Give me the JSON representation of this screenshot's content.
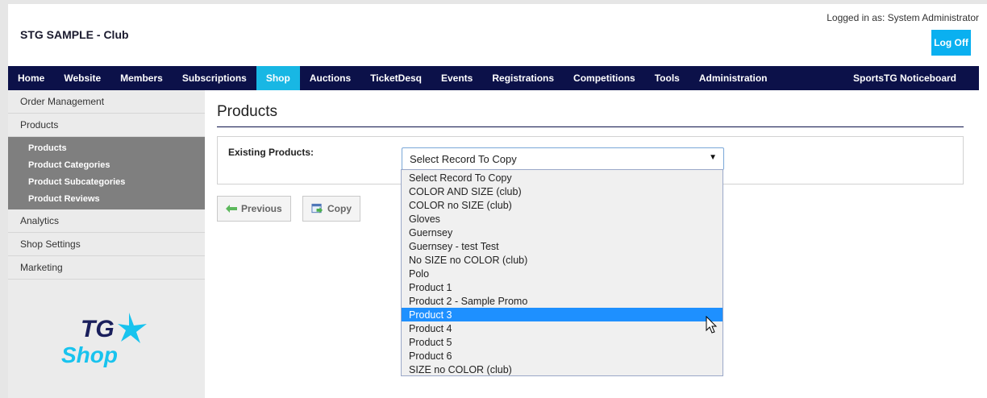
{
  "header": {
    "club_title": "STG SAMPLE - Club",
    "logged_in": "Logged in as: System Administrator",
    "logoff_label": "Log Off"
  },
  "nav": {
    "items": [
      "Home",
      "Website",
      "Members",
      "Subscriptions",
      "Shop",
      "Auctions",
      "TicketDesq",
      "Events",
      "Registrations",
      "Competitions",
      "Tools",
      "Administration"
    ],
    "active": "Shop",
    "right_item": "SportsTG Noticeboard"
  },
  "sidebar": {
    "order_management": "Order Management",
    "products": "Products",
    "sub_items": [
      "Products",
      "Product Categories",
      "Product Subcategories",
      "Product Reviews"
    ],
    "analytics": "Analytics",
    "shop_settings": "Shop Settings",
    "marketing": "Marketing",
    "logo_top": "TG",
    "logo_bottom": "Shop"
  },
  "main": {
    "page_title": "Products",
    "existing_label": "Existing Products:",
    "select_value": "Select Record To Copy",
    "previous_label": "Previous",
    "copy_label": "Copy"
  },
  "dropdown": {
    "options": [
      "Select Record To Copy",
      "COLOR AND SIZE (club)",
      "COLOR no SIZE (club)",
      "Gloves",
      "Guernsey",
      "Guernsey - test Test",
      "No SIZE no COLOR (club)",
      "Polo",
      "Product 1",
      "Product 2 - Sample Promo",
      "Product 3",
      "Product 4",
      "Product 5",
      "Product 6",
      "SIZE no COLOR (club)"
    ],
    "highlighted": "Product 3"
  },
  "colors": {
    "nav_bg": "#0c1149",
    "nav_active": "#18b7e4",
    "logoff_bg": "#0ab0f0",
    "highlight": "#1e90ff",
    "logo_dark": "#1a1f5c",
    "logo_cyan": "#18c3ee"
  }
}
